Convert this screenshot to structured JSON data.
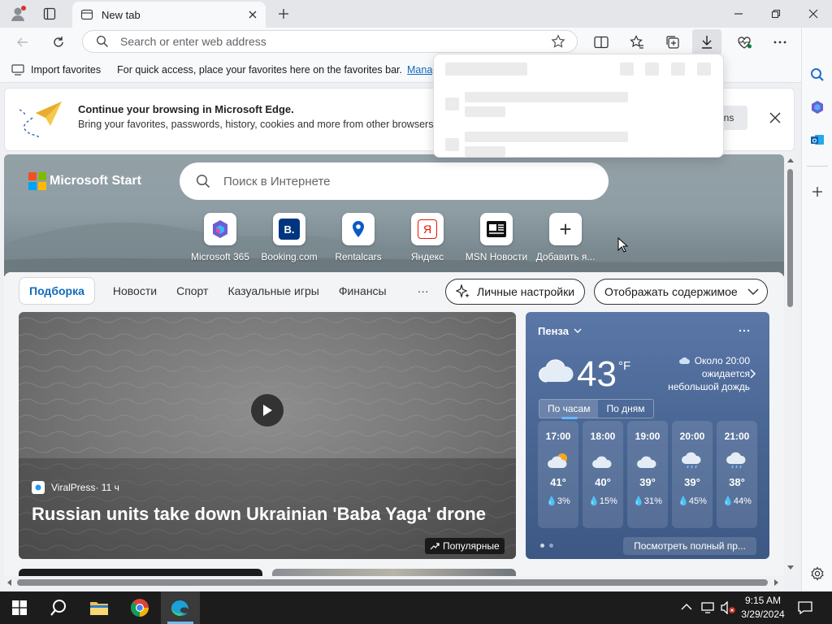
{
  "browser": {
    "tab_title": "New tab",
    "address_placeholder": "Search or enter web address",
    "favorites": {
      "import_label": "Import favorites",
      "hint": "For quick access, place your favorites here on the favorites bar.",
      "manage_label": "Manage"
    },
    "banner": {
      "title": "Continue your browsing in Microsoft Edge.",
      "text": "Bring your favorites, passwords, history, cookies and more from other browsers ea",
      "button_fragment": "ns"
    }
  },
  "start": {
    "logo_text": "Microsoft Start",
    "search_placeholder": "Поиск в Интернете",
    "quick_links": [
      {
        "label": "Microsoft 365",
        "icon": "microsoft-365-icon"
      },
      {
        "label": "Booking.com",
        "icon": "booking-icon",
        "glyph": "B."
      },
      {
        "label": "Rentalcars",
        "icon": "rentalcars-icon"
      },
      {
        "label": "Яндекс",
        "icon": "yandex-icon",
        "glyph": "Я"
      },
      {
        "label": "MSN Новости",
        "icon": "msn-news-icon"
      },
      {
        "label": "Добавить я...",
        "icon": "plus-icon",
        "glyph": "+"
      }
    ],
    "nav_tabs": [
      "Подборка",
      "Новости",
      "Спорт",
      "Казуальные игры",
      "Финансы"
    ],
    "more_glyph": "···",
    "personalize_label": "Личные настройки",
    "display_label": "Отображать содержимое"
  },
  "news": {
    "source": "ViralPress",
    "age": " · 11 ч",
    "headline": "Russian units take down Ukrainian 'Baba Yaga' drone",
    "badge": "Популярные"
  },
  "weather": {
    "city": "Пенза",
    "temperature": "43",
    "unit": "°F",
    "forecast_line1": "Около 20:00",
    "forecast_line2": "ожидается",
    "forecast_line3": "небольшой дождь",
    "tab_hourly": "По часам",
    "tab_daily": "По дням",
    "hours": [
      {
        "time": "17:00",
        "temp": "41°",
        "precip": "3%",
        "icon": "partly-sunny-icon"
      },
      {
        "time": "18:00",
        "temp": "40°",
        "precip": "15%",
        "icon": "cloud-icon"
      },
      {
        "time": "19:00",
        "temp": "39°",
        "precip": "31%",
        "icon": "cloud-icon"
      },
      {
        "time": "20:00",
        "temp": "39°",
        "precip": "45%",
        "icon": "rain-cloud-icon"
      },
      {
        "time": "21:00",
        "temp": "38°",
        "precip": "44%",
        "icon": "rain-cloud-icon"
      }
    ],
    "see_full": "Посмотреть полный пр..."
  },
  "taskbar": {
    "time": "9:15 AM",
    "date": "3/29/2024"
  },
  "colors": {
    "accent": "#0f6cbd",
    "weather_bg": "#3b5a85",
    "taskbar": "#1c1c1c"
  }
}
